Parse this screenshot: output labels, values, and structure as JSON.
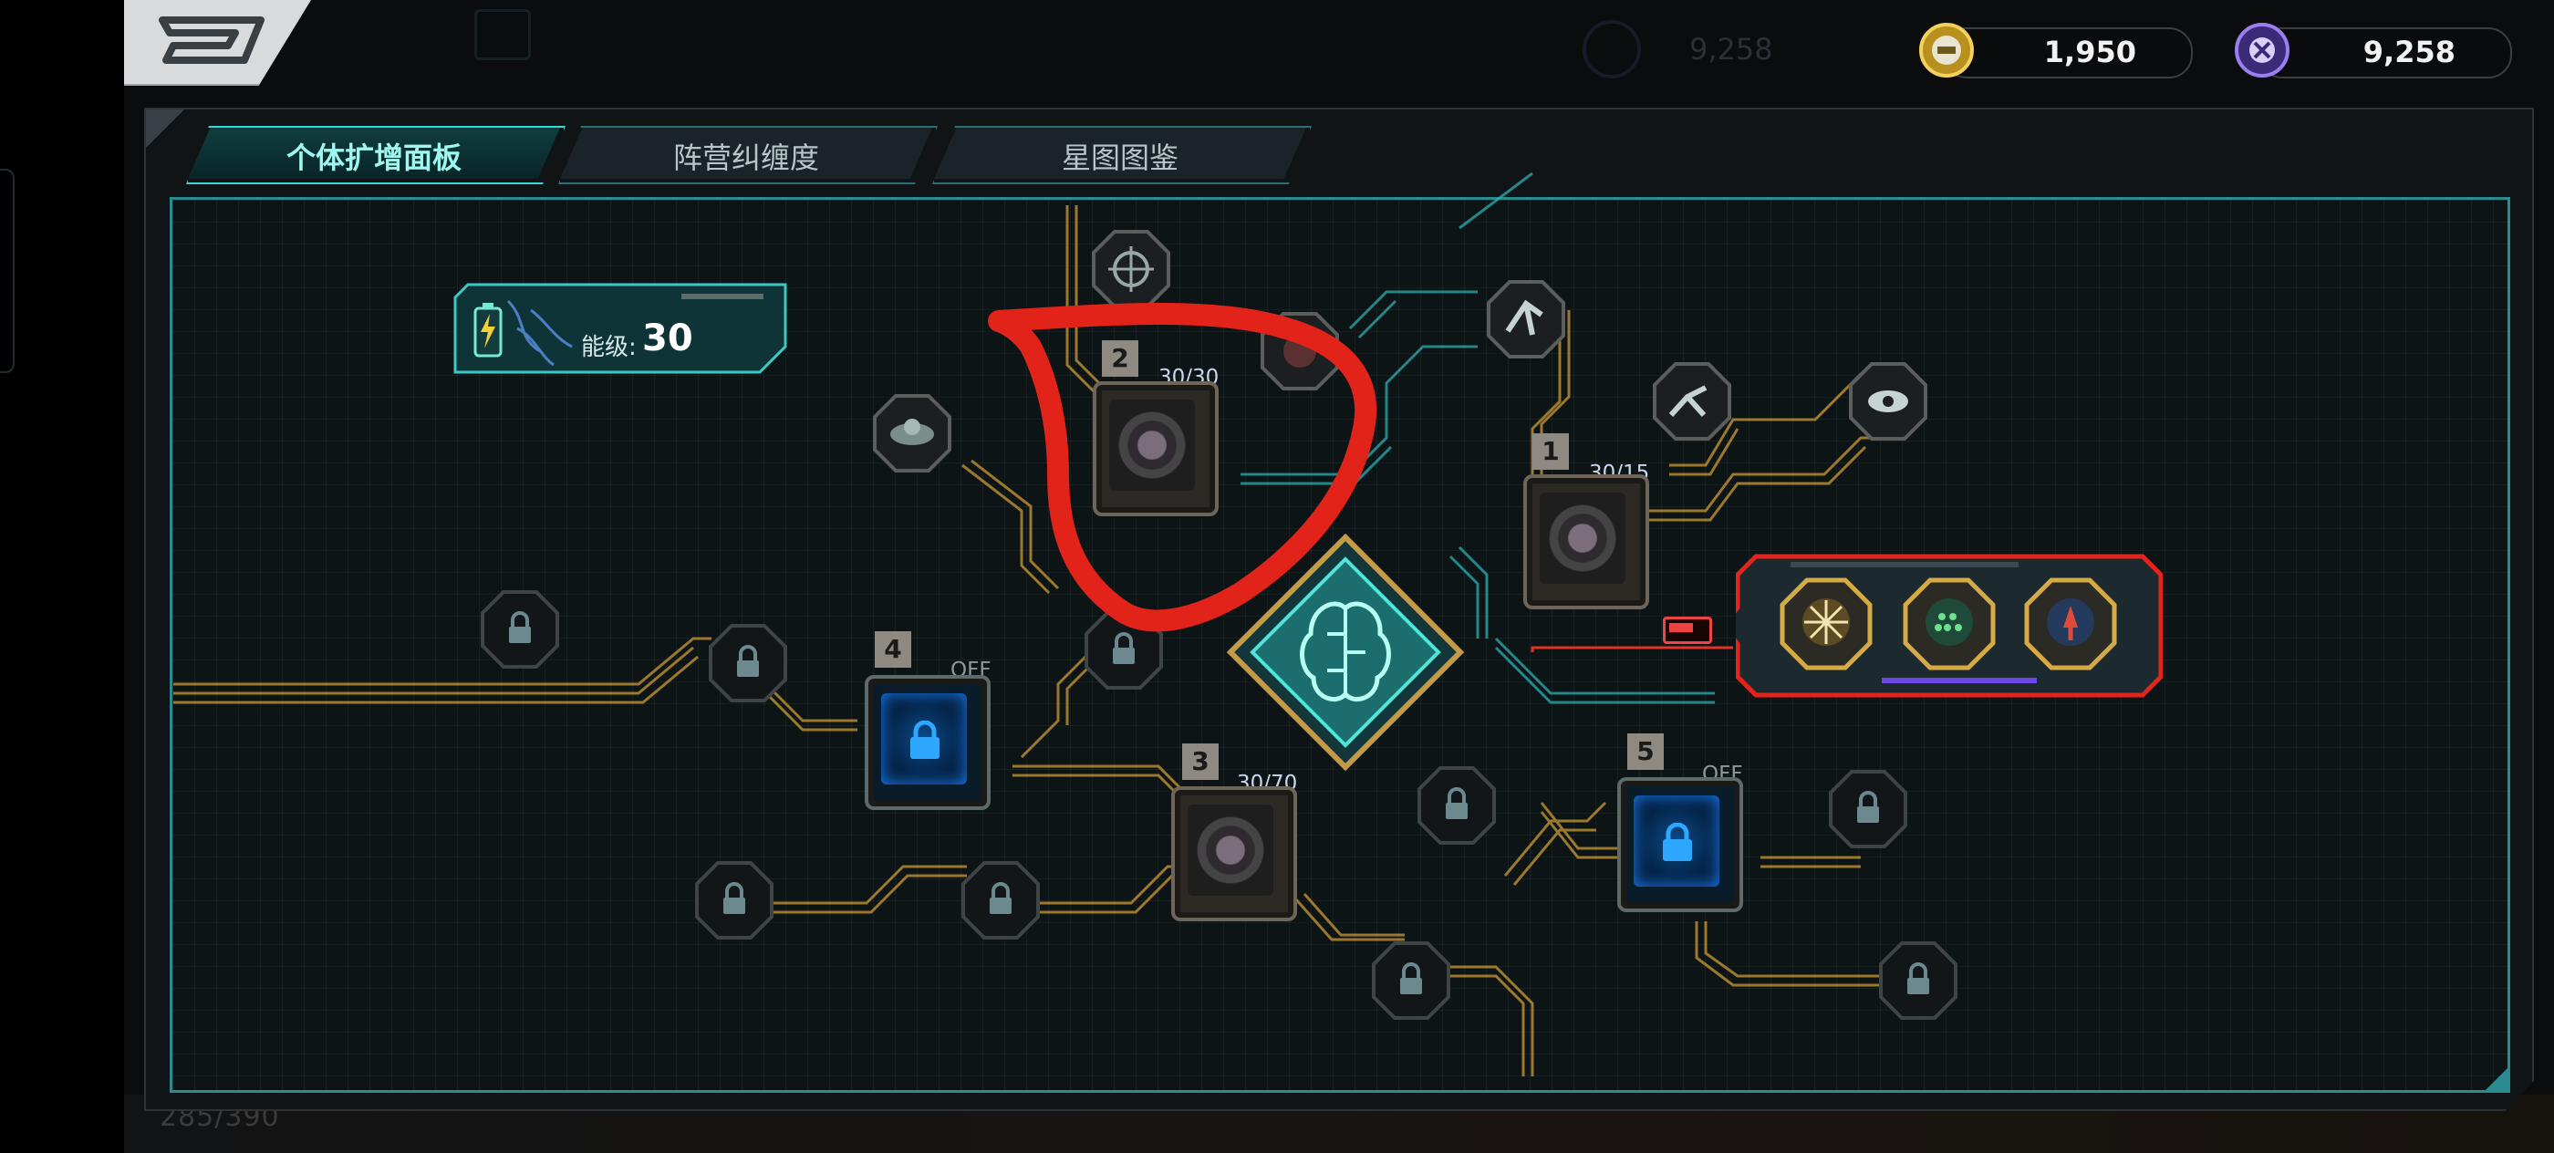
{
  "header": {
    "back_icon": "back-arrow-icon",
    "currencies": [
      {
        "icon": "gold-coin-icon",
        "value": "1,950",
        "color": "#d8b13a"
      },
      {
        "icon": "purple-gem-icon",
        "value": "9,258",
        "color": "#8a6be0"
      }
    ],
    "ghost_value": "9,258"
  },
  "tabs": [
    {
      "label": "个体扩增面板",
      "active": true
    },
    {
      "label": "阵营纠缠度",
      "active": false
    },
    {
      "label": "星图图鉴",
      "active": false
    }
  ],
  "energy": {
    "icon": "battery-icon",
    "label": "能级:",
    "value": "30"
  },
  "nodes": [
    {
      "number": "1",
      "progress": "30/15",
      "icon": "star-emblem-icon"
    },
    {
      "number": "2",
      "progress": "30/30",
      "icon": "flower-emblem-icon"
    },
    {
      "number": "3",
      "progress": "30/70",
      "icon": "eye-emblem-icon"
    },
    {
      "number": "4",
      "status": "OFF",
      "icon": "lock-icon"
    },
    {
      "number": "5",
      "status": "OFF",
      "icon": "lock-icon"
    }
  ],
  "bonus_panel": {
    "icons": [
      "burst-medal-icon",
      "dots-medal-icon",
      "figure-medal-icon"
    ]
  },
  "center": {
    "icon": "brain-chip-icon"
  },
  "bottom_ghost": "285/390",
  "colors": {
    "accent": "#2a8b90",
    "tab_active": "#9ef7f0",
    "circuit": "#b58a32",
    "annotation": "#e2231a"
  }
}
